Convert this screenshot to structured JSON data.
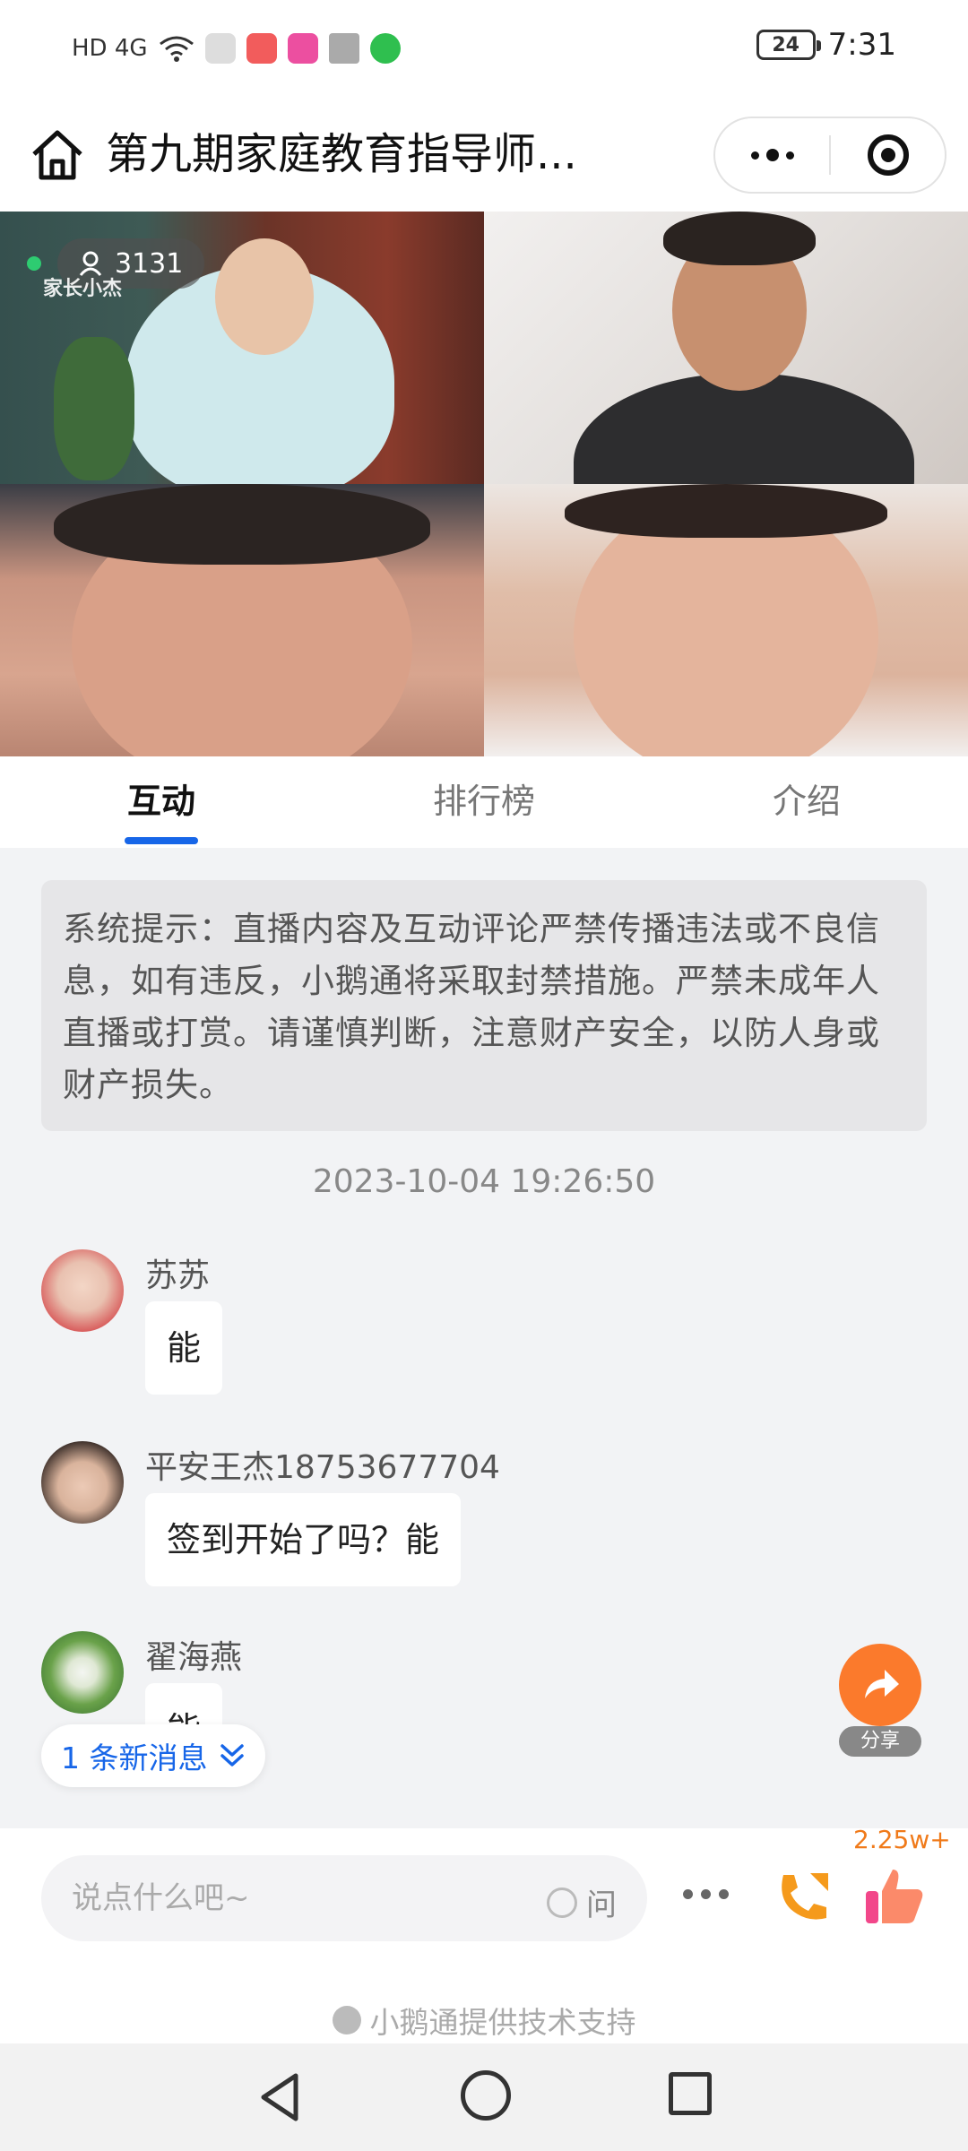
{
  "status_bar": {
    "left_text": "HD 4G",
    "battery": "24",
    "time": "7:31"
  },
  "title_bar": {
    "title": "第九期家庭教育指导师..."
  },
  "video": {
    "viewer_count": "3131",
    "watermark": "家长小杰"
  },
  "tabs": [
    {
      "label": "互动",
      "active": true
    },
    {
      "label": "排行榜",
      "active": false
    },
    {
      "label": "介绍",
      "active": false
    }
  ],
  "notice": "系统提示：直播内容及互动评论严禁传播违法或不良信息，如有违反，小鹅通将采取封禁措施。严禁未成年人直播或打赏。请谨慎判断，注意财产安全，以防人身或财产损失。",
  "timestamp": "2023-10-04 19:26:50",
  "messages": [
    {
      "name": "苏苏",
      "text": "能"
    },
    {
      "name": "平安王杰18753677704",
      "text": "签到开始了吗？能"
    },
    {
      "name": "翟海燕",
      "text": "能"
    }
  ],
  "new_messages": "1 条新消息",
  "share_label": "分享",
  "bottom": {
    "placeholder": "说点什么吧~",
    "ask_label": "问",
    "like_count": "2.25w+",
    "powered_by": "小鹅通提供技术支持"
  },
  "colors": {
    "accent": "#1766e8",
    "share": "#fb7a2c",
    "like_count": "#f07a1a",
    "live_dot": "#2ecc71"
  }
}
